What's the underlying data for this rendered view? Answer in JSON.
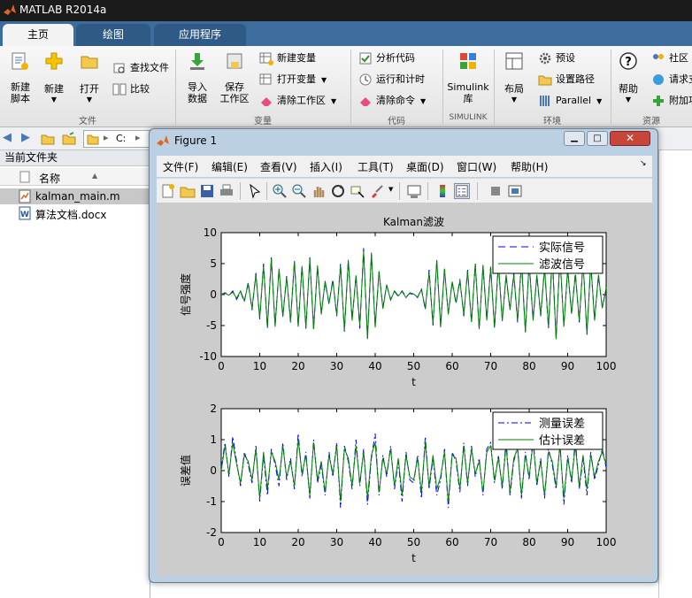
{
  "app": {
    "title": "MATLAB R2014a"
  },
  "tabs": [
    {
      "label": "主页"
    },
    {
      "label": "绘图"
    },
    {
      "label": "应用程序"
    }
  ],
  "ribbon": {
    "file": {
      "new_script": "新建\n脚本",
      "new": "新建",
      "open": "打开",
      "find_files": "查找文件",
      "compare": "比较",
      "group": "文件"
    },
    "variable": {
      "import": "导入\n数据",
      "save_ws": "保存\n工作区",
      "new_var": "新建变量",
      "open_var": "打开变量",
      "clear_ws": "清除工作区",
      "group": "变量"
    },
    "code": {
      "analyze": "分析代码",
      "run_time": "运行和计时",
      "clear_cmd": "清除命令",
      "group": "代码"
    },
    "simulink": {
      "lib": "Simulink\n库",
      "group": "SIMULINK"
    },
    "env": {
      "layout": "布局",
      "prefs": "预设",
      "set_path": "设置路径",
      "parallel": "Parallel",
      "group": "环境"
    },
    "resources": {
      "help": "帮助",
      "community": "社区",
      "request": "请求支",
      "addons": "附加项",
      "group": "资源"
    }
  },
  "pathbar": {
    "path": "C:"
  },
  "folder": {
    "title": "当前文件夹",
    "col_name": "名称",
    "files": [
      {
        "name": "kalman_main.m"
      },
      {
        "name": "算法文档.docx"
      }
    ]
  },
  "figure": {
    "title": "Figure 1",
    "menu": [
      "文件(F)",
      "编辑(E)",
      "查看(V)",
      "插入(I)",
      "工具(T)",
      "桌面(D)",
      "窗口(W)",
      "帮助(H)"
    ]
  },
  "colors": {
    "actual": "#0000ff",
    "filtered": "#008000",
    "axis_bg": "#ffffff",
    "fig_bg": "#cccccc"
  },
  "chart_data": [
    {
      "type": "line",
      "title": "Kalman滤波",
      "xlabel": "t",
      "ylabel": "信号强度",
      "xlim": [
        0,
        100
      ],
      "ylim": [
        -10,
        10
      ],
      "xticks": [
        0,
        10,
        20,
        30,
        40,
        50,
        60,
        70,
        80,
        90,
        100
      ],
      "yticks": [
        -10,
        -5,
        0,
        5,
        10
      ],
      "legend": "top-right",
      "x": [
        0,
        1,
        2,
        3,
        4,
        5,
        6,
        7,
        8,
        9,
        10,
        11,
        12,
        13,
        14,
        15,
        16,
        17,
        18,
        19,
        20,
        21,
        22,
        23,
        24,
        25,
        26,
        27,
        28,
        29,
        30,
        31,
        32,
        33,
        34,
        35,
        36,
        37,
        38,
        39,
        40,
        41,
        42,
        43,
        44,
        45,
        46,
        47,
        48,
        49,
        50,
        51,
        52,
        53,
        54,
        55,
        56,
        57,
        58,
        59,
        60,
        61,
        62,
        63,
        64,
        65,
        66,
        67,
        68,
        69,
        70,
        71,
        72,
        73,
        74,
        75,
        76,
        77,
        78,
        79,
        80,
        81,
        82,
        83,
        84,
        85,
        86,
        87,
        88,
        89,
        90,
        91,
        92,
        93,
        94,
        95,
        96,
        97,
        98,
        99,
        100
      ],
      "series": [
        {
          "name": "实际信号",
          "style": "dashed",
          "color": "#0000ff",
          "values": [
            0.0,
            0.3,
            -0.2,
            0.6,
            -0.8,
            0.5,
            -1.2,
            2.0,
            -2.5,
            3.5,
            -4.0,
            5.0,
            -5.5,
            6.0,
            -5.0,
            4.0,
            -3.5,
            3.0,
            -4.5,
            5.5,
            -5.0,
            4.5,
            -5.5,
            6.0,
            -5.5,
            4.5,
            -3.0,
            2.0,
            -1.5,
            2.5,
            -3.5,
            5.0,
            -6.0,
            5.5,
            -4.0,
            3.0,
            -5.5,
            7.5,
            -7.0,
            6.5,
            -5.0,
            3.5,
            -2.0,
            1.5,
            -0.8,
            0.5,
            -0.3,
            0.6,
            -0.4,
            0.2,
            0.0,
            -0.5,
            1.0,
            -2.5,
            4.0,
            -5.0,
            5.5,
            -5.0,
            4.0,
            -3.0,
            2.0,
            -1.5,
            2.5,
            -3.5,
            4.0,
            -4.5,
            5.0,
            -5.5,
            4.5,
            -4.0,
            4.5,
            -5.5,
            5.0,
            -4.0,
            3.0,
            -2.5,
            3.5,
            -4.5,
            5.5,
            -6.0,
            5.0,
            -4.0,
            3.0,
            -3.5,
            4.5,
            -5.5,
            6.5,
            -7.0,
            6.0,
            -5.0,
            4.0,
            -3.0,
            3.5,
            -4.5,
            5.5,
            -6.5,
            5.0,
            -4.0,
            3.0,
            -2.0,
            1.0
          ]
        },
        {
          "name": "滤波信号",
          "style": "solid",
          "color": "#008000",
          "values": [
            0.0,
            0.2,
            -0.1,
            0.4,
            -0.6,
            0.6,
            -1.0,
            1.7,
            -2.2,
            3.2,
            -3.8,
            4.6,
            -5.2,
            5.8,
            -5.2,
            4.2,
            -3.6,
            2.8,
            -4.2,
            5.2,
            -5.2,
            4.6,
            -5.3,
            5.8,
            -5.6,
            4.7,
            -3.2,
            2.2,
            -1.4,
            2.2,
            -3.2,
            4.6,
            -5.7,
            5.6,
            -4.2,
            3.1,
            -5.0,
            7.0,
            -7.2,
            6.8,
            -5.3,
            3.8,
            -2.3,
            1.6,
            -0.9,
            0.6,
            -0.2,
            0.5,
            -0.5,
            0.3,
            0.1,
            -0.4,
            0.8,
            -2.2,
            3.6,
            -4.8,
            5.6,
            -5.3,
            4.2,
            -3.2,
            2.1,
            -1.3,
            2.2,
            -3.2,
            3.8,
            -4.4,
            5.0,
            -5.6,
            4.8,
            -4.2,
            4.4,
            -5.3,
            5.2,
            -4.3,
            3.2,
            -2.4,
            3.2,
            -4.2,
            5.2,
            -6.1,
            5.3,
            -4.2,
            3.2,
            -3.3,
            4.2,
            -5.2,
            6.2,
            -7.2,
            6.3,
            -5.2,
            4.2,
            -3.1,
            3.2,
            -4.2,
            5.2,
            -6.3,
            5.2,
            -4.2,
            3.2,
            -2.2,
            1.1
          ]
        }
      ]
    },
    {
      "type": "line",
      "title": "",
      "xlabel": "t",
      "ylabel": "误差值",
      "xlim": [
        0,
        100
      ],
      "ylim": [
        -2,
        2
      ],
      "xticks": [
        0,
        10,
        20,
        30,
        40,
        50,
        60,
        70,
        80,
        90,
        100
      ],
      "yticks": [
        -2,
        -1,
        0,
        1,
        2
      ],
      "legend": "top-right",
      "x": [
        0,
        1,
        2,
        3,
        4,
        5,
        6,
        7,
        8,
        9,
        10,
        11,
        12,
        13,
        14,
        15,
        16,
        17,
        18,
        19,
        20,
        21,
        22,
        23,
        24,
        25,
        26,
        27,
        28,
        29,
        30,
        31,
        32,
        33,
        34,
        35,
        36,
        37,
        38,
        39,
        40,
        41,
        42,
        43,
        44,
        45,
        46,
        47,
        48,
        49,
        50,
        51,
        52,
        53,
        54,
        55,
        56,
        57,
        58,
        59,
        60,
        61,
        62,
        63,
        64,
        65,
        66,
        67,
        68,
        69,
        70,
        71,
        72,
        73,
        74,
        75,
        76,
        77,
        78,
        79,
        80,
        81,
        82,
        83,
        84,
        85,
        86,
        87,
        88,
        89,
        90,
        91,
        92,
        93,
        94,
        95,
        96,
        97,
        98,
        99,
        100
      ],
      "series": [
        {
          "name": "测量误差",
          "style": "dashdot",
          "color": "#0000ff",
          "values": [
            0.1,
            0.9,
            -0.2,
            1.1,
            0.3,
            -0.5,
            0.6,
            0.2,
            -0.4,
            0.8,
            -1.0,
            0.5,
            -0.8,
            0.7,
            0.2,
            -0.5,
            0.9,
            -0.3,
            0.4,
            -0.6,
            1.2,
            -0.2,
            0.6,
            -0.9,
            1.0,
            -0.4,
            0.2,
            -0.8,
            0.6,
            -0.2,
            0.9,
            -1.2,
            0.8,
            0.3,
            -0.6,
            1.0,
            -0.5,
            0.7,
            -1.1,
            0.4,
            1.2,
            -0.8,
            0.5,
            -0.2,
            0.8,
            -0.6,
            0.3,
            -1.0,
            0.6,
            -0.3,
            -0.4,
            0.5,
            -0.9,
            1.1,
            -0.6,
            0.4,
            -0.8,
            -0.3,
            0.7,
            -1.2,
            0.6,
            0.3,
            -0.7,
            0.9,
            -0.5,
            0.8,
            -0.2,
            0.4,
            -0.8,
            0.7,
            0.9,
            -0.4,
            0.5,
            -0.6,
            1.0,
            -0.8,
            0.3,
            0.8,
            -0.9,
            0.6,
            -0.3,
            1.1,
            -0.5,
            0.4,
            -0.9,
            0.7,
            0.2,
            -0.6,
            0.9,
            -1.1,
            0.5,
            -0.4,
            1.0,
            -0.6,
            0.4,
            -0.8,
            0.6,
            -0.3,
            0.2,
            0.7,
            0.1
          ]
        },
        {
          "name": "估计误差",
          "style": "solid",
          "color": "#008000",
          "values": [
            0.0,
            0.8,
            -0.1,
            0.9,
            0.2,
            -0.4,
            0.5,
            0.3,
            -0.3,
            0.7,
            -0.9,
            0.6,
            -0.6,
            0.6,
            0.3,
            -0.3,
            0.8,
            -0.2,
            0.3,
            -0.5,
            1.0,
            -0.1,
            0.5,
            -0.8,
            0.9,
            -0.3,
            0.3,
            -0.7,
            0.5,
            -0.1,
            0.8,
            -1.0,
            0.7,
            0.4,
            -0.5,
            0.8,
            -0.4,
            0.6,
            -0.9,
            0.5,
            0.9,
            -0.7,
            0.4,
            -0.1,
            0.7,
            -0.5,
            0.4,
            -0.8,
            0.5,
            -0.2,
            -0.3,
            0.4,
            -0.7,
            0.9,
            -0.5,
            0.5,
            -0.6,
            -0.2,
            0.6,
            -1.0,
            0.5,
            0.4,
            -0.6,
            0.8,
            -0.4,
            0.7,
            -0.1,
            0.3,
            -0.7,
            0.6,
            0.8,
            -0.3,
            0.4,
            -0.5,
            0.8,
            -0.7,
            0.4,
            0.7,
            -0.8,
            0.5,
            -0.2,
            0.9,
            -0.4,
            0.3,
            -0.8,
            0.6,
            0.3,
            -0.5,
            0.8,
            -0.9,
            0.4,
            -0.3,
            0.8,
            -0.5,
            0.5,
            -0.6,
            0.5,
            -0.2,
            0.3,
            0.6,
            0.2
          ]
        }
      ]
    }
  ]
}
